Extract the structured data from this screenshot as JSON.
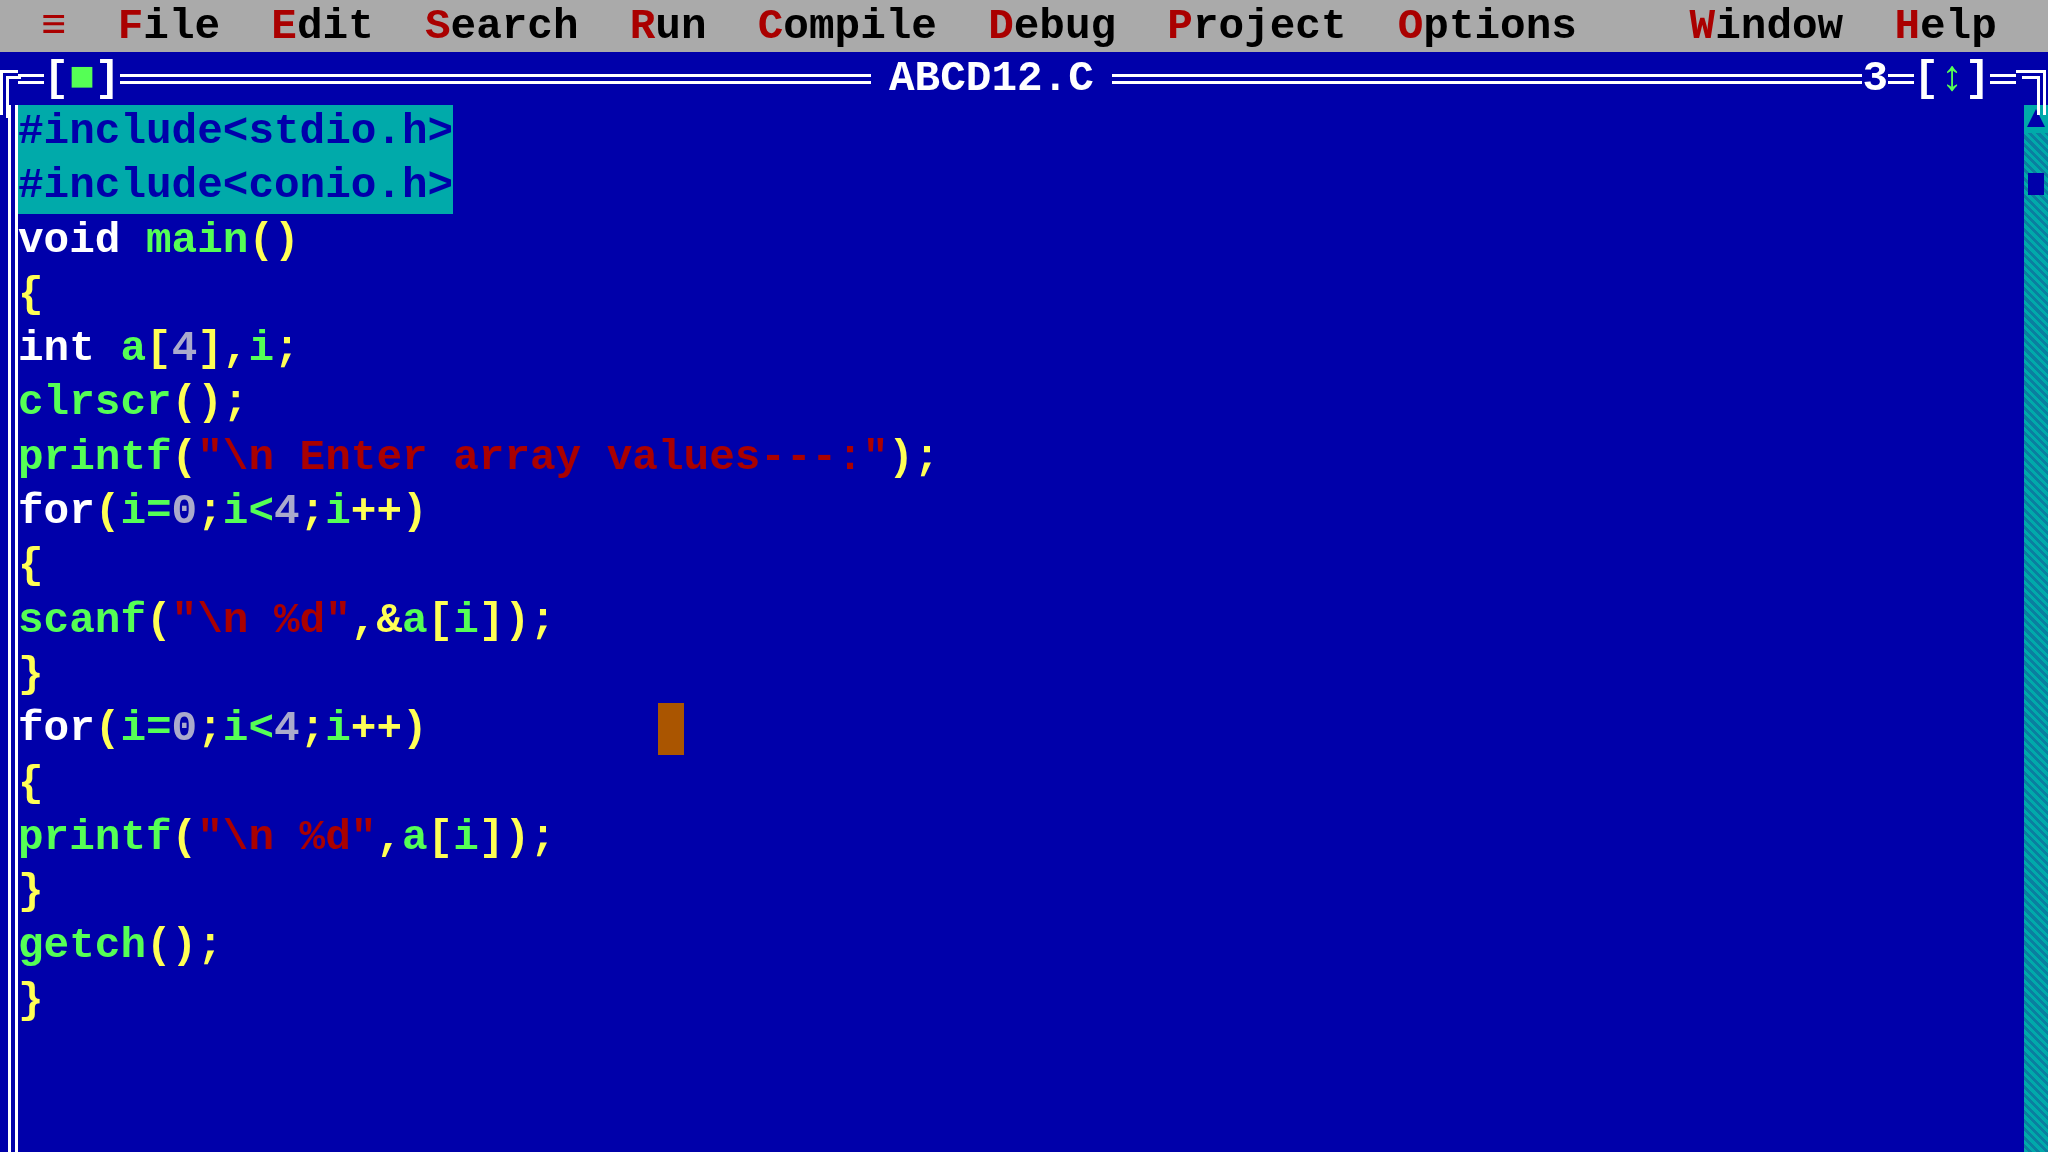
{
  "menu_bar": {
    "items": [
      {
        "label": "≡"
      },
      {
        "label": "File"
      },
      {
        "label": "Edit"
      },
      {
        "label": "Search"
      },
      {
        "label": "Run"
      },
      {
        "label": "Compile"
      },
      {
        "label": "Debug"
      },
      {
        "label": "Project"
      },
      {
        "label": "Options"
      }
    ],
    "right_items": [
      {
        "label": "Window"
      },
      {
        "label": "Help"
      }
    ]
  },
  "editor": {
    "close_button": "[■]",
    "title": "ABCD12.C",
    "window_number": "3",
    "zoom_button": "[↕]",
    "lines": [
      {
        "selected": true,
        "cursor": false,
        "tokens": [
          {
            "kind": "preprocessor",
            "text": "#include<stdio.h>"
          }
        ]
      },
      {
        "selected": true,
        "cursor": false,
        "tokens": [
          {
            "kind": "preprocessor",
            "text": "#include<conio.h>"
          }
        ]
      },
      {
        "selected": false,
        "cursor": false,
        "tokens": [
          {
            "kind": "keyword",
            "text": "void "
          },
          {
            "kind": "identifier",
            "text": "main"
          },
          {
            "kind": "symbol",
            "text": "()"
          }
        ]
      },
      {
        "selected": false,
        "cursor": false,
        "tokens": [
          {
            "kind": "symbol",
            "text": "{"
          }
        ]
      },
      {
        "selected": false,
        "cursor": false,
        "tokens": [
          {
            "kind": "keyword",
            "text": "int "
          },
          {
            "kind": "identifier",
            "text": "a"
          },
          {
            "kind": "symbol",
            "text": "["
          },
          {
            "kind": "number",
            "text": "4"
          },
          {
            "kind": "symbol",
            "text": "],"
          },
          {
            "kind": "identifier",
            "text": "i"
          },
          {
            "kind": "symbol",
            "text": ";"
          }
        ]
      },
      {
        "selected": false,
        "cursor": false,
        "tokens": [
          {
            "kind": "identifier",
            "text": "clrscr"
          },
          {
            "kind": "symbol",
            "text": "();"
          }
        ]
      },
      {
        "selected": false,
        "cursor": false,
        "tokens": [
          {
            "kind": "identifier",
            "text": "printf"
          },
          {
            "kind": "symbol",
            "text": "("
          },
          {
            "kind": "string",
            "text": "\"\\n Enter array values---:\""
          },
          {
            "kind": "symbol",
            "text": ");"
          }
        ]
      },
      {
        "selected": false,
        "cursor": false,
        "tokens": [
          {
            "kind": "keyword",
            "text": "for"
          },
          {
            "kind": "symbol",
            "text": "("
          },
          {
            "kind": "identifier",
            "text": "i="
          },
          {
            "kind": "number",
            "text": "0"
          },
          {
            "kind": "symbol",
            "text": ";"
          },
          {
            "kind": "identifier",
            "text": "i<"
          },
          {
            "kind": "number",
            "text": "4"
          },
          {
            "kind": "symbol",
            "text": ";"
          },
          {
            "kind": "identifier",
            "text": "i"
          },
          {
            "kind": "symbol",
            "text": "++)"
          }
        ]
      },
      {
        "selected": false,
        "cursor": false,
        "tokens": [
          {
            "kind": "symbol",
            "text": "{"
          }
        ]
      },
      {
        "selected": false,
        "cursor": false,
        "tokens": [
          {
            "kind": "identifier",
            "text": "scanf"
          },
          {
            "kind": "symbol",
            "text": "("
          },
          {
            "kind": "string",
            "text": "\"\\n %d\""
          },
          {
            "kind": "symbol",
            "text": ",&"
          },
          {
            "kind": "identifier",
            "text": "a"
          },
          {
            "kind": "symbol",
            "text": "["
          },
          {
            "kind": "identifier",
            "text": "i"
          },
          {
            "kind": "symbol",
            "text": "]);"
          }
        ]
      },
      {
        "selected": false,
        "cursor": false,
        "tokens": [
          {
            "kind": "symbol",
            "text": "}"
          }
        ]
      },
      {
        "selected": false,
        "cursor": true,
        "tokens": [
          {
            "kind": "keyword",
            "text": "for"
          },
          {
            "kind": "symbol",
            "text": "("
          },
          {
            "kind": "identifier",
            "text": "i="
          },
          {
            "kind": "number",
            "text": "0"
          },
          {
            "kind": "symbol",
            "text": ";"
          },
          {
            "kind": "identifier",
            "text": "i<"
          },
          {
            "kind": "number",
            "text": "4"
          },
          {
            "kind": "symbol",
            "text": ";"
          },
          {
            "kind": "identifier",
            "text": "i"
          },
          {
            "kind": "symbol",
            "text": "++)"
          }
        ]
      },
      {
        "selected": false,
        "cursor": false,
        "tokens": [
          {
            "kind": "symbol",
            "text": "{"
          }
        ]
      },
      {
        "selected": false,
        "cursor": false,
        "tokens": [
          {
            "kind": "identifier",
            "text": "printf"
          },
          {
            "kind": "symbol",
            "text": "("
          },
          {
            "kind": "string",
            "text": "\"\\n %d\""
          },
          {
            "kind": "symbol",
            "text": ","
          },
          {
            "kind": "identifier",
            "text": "a"
          },
          {
            "kind": "symbol",
            "text": "["
          },
          {
            "kind": "identifier",
            "text": "i"
          },
          {
            "kind": "symbol",
            "text": "]);"
          }
        ]
      },
      {
        "selected": false,
        "cursor": false,
        "tokens": [
          {
            "kind": "symbol",
            "text": "}"
          }
        ]
      },
      {
        "selected": false,
        "cursor": false,
        "tokens": [
          {
            "kind": "identifier",
            "text": "getch"
          },
          {
            "kind": "symbol",
            "text": "();"
          }
        ]
      },
      {
        "selected": false,
        "cursor": false,
        "tokens": [
          {
            "kind": "symbol",
            "text": "}"
          }
        ]
      }
    ]
  }
}
